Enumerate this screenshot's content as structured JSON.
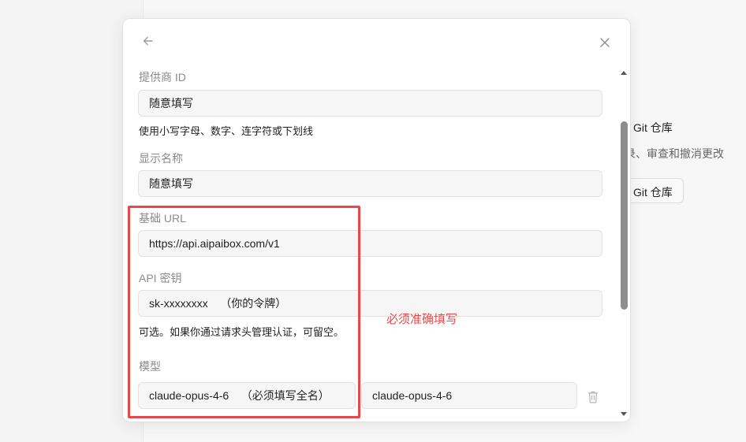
{
  "background": {
    "git_title": "Git 仓库",
    "git_description": "录、审查和撤消更改",
    "git_button_label": "Git 仓库"
  },
  "modal": {
    "provider_id": {
      "label": "提供商 ID",
      "value": "随意填写",
      "hint": "使用小写字母、数字、连字符或下划线"
    },
    "display_name": {
      "label": "显示名称",
      "value": "随意填写"
    },
    "base_url": {
      "label": "基础 URL",
      "value": "https://api.aipaibox.com/v1"
    },
    "api_key": {
      "label": "API 密钥",
      "value": "sk-xxxxxxxx    （你的令牌）",
      "hint": "可选。如果你通过请求头管理认证，可留空。"
    },
    "models": {
      "label": "模型",
      "model_id_value": "claude-opus-4-6    （必须填写全名）",
      "model_name_value": "claude-opus-4-6"
    }
  },
  "annotation": {
    "text": "必须准确填写",
    "color": "#e8484a"
  },
  "icons": [
    "arrow-left-icon",
    "close-icon",
    "trash-icon",
    "scroll-up-icon",
    "scroll-down-icon"
  ]
}
